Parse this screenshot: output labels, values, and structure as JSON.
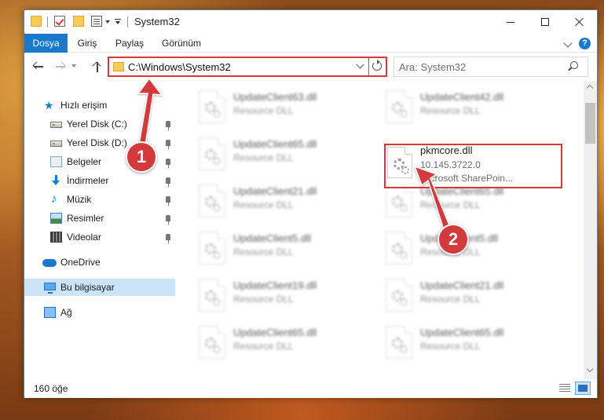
{
  "window": {
    "title": "System32"
  },
  "ribbon": {
    "tabs": [
      {
        "label": "Dosya"
      },
      {
        "label": "Giriş"
      },
      {
        "label": "Paylaş"
      },
      {
        "label": "Görünüm"
      }
    ],
    "help": "?"
  },
  "address": {
    "path": "C:\\Windows\\System32",
    "search_placeholder": "Ara: System32"
  },
  "nav": {
    "items": [
      {
        "label": "Hızlı erişim",
        "icon": "star-icon"
      },
      {
        "label": "Yerel Disk (C:)",
        "icon": "drive-icon"
      },
      {
        "label": "Yerel Disk (D:)",
        "icon": "drive-icon"
      },
      {
        "label": "Belgeler",
        "icon": "documents-icon"
      },
      {
        "label": "İndirmeler",
        "icon": "downloads-icon"
      },
      {
        "label": "Müzik",
        "icon": "music-icon"
      },
      {
        "label": "Resimler",
        "icon": "pictures-icon"
      },
      {
        "label": "Videolar",
        "icon": "videos-icon"
      },
      {
        "label": "OneDrive",
        "icon": "cloud-icon"
      },
      {
        "label": "Bu bilgisayar",
        "icon": "computer-icon"
      },
      {
        "label": "Ağ",
        "icon": "network-icon"
      }
    ]
  },
  "files": {
    "left": [
      {
        "name": "UpdateClient63.dll",
        "type": "Resource DLL"
      },
      {
        "name": "UpdateClient65.dll",
        "type": "Resource DLL"
      },
      {
        "name": "UpdateClient21.dll",
        "type": "Resource DLL"
      },
      {
        "name": "UpdateClient5.dll",
        "type": "Resource DLL"
      },
      {
        "name": "UpdateClient19.dll",
        "type": "Resource DLL"
      },
      {
        "name": "UpdateClient65.dll",
        "type": "Resource DLL"
      }
    ],
    "right": [
      {
        "name": "UpdateClient42.dll",
        "type": "Resource DLL"
      },
      {
        "name": "UpdateClient65.dll",
        "type": "Resource DLL"
      },
      {
        "name": "UpdateClient5.dll",
        "type": "Resource DLL"
      },
      {
        "name": "UpdateClient21.dll",
        "type": "Resource DLL"
      },
      {
        "name": "UpdateClient65.dll",
        "type": "Resource DLL"
      }
    ],
    "highlighted": {
      "name": "pkmcore.dll",
      "version": "10.145.3722.0",
      "description": "Microsoft SharePoin..."
    }
  },
  "status": {
    "item_count": "160 öğe"
  },
  "annotations": {
    "step1": "1",
    "step2": "2",
    "color": "#d23a3c"
  }
}
